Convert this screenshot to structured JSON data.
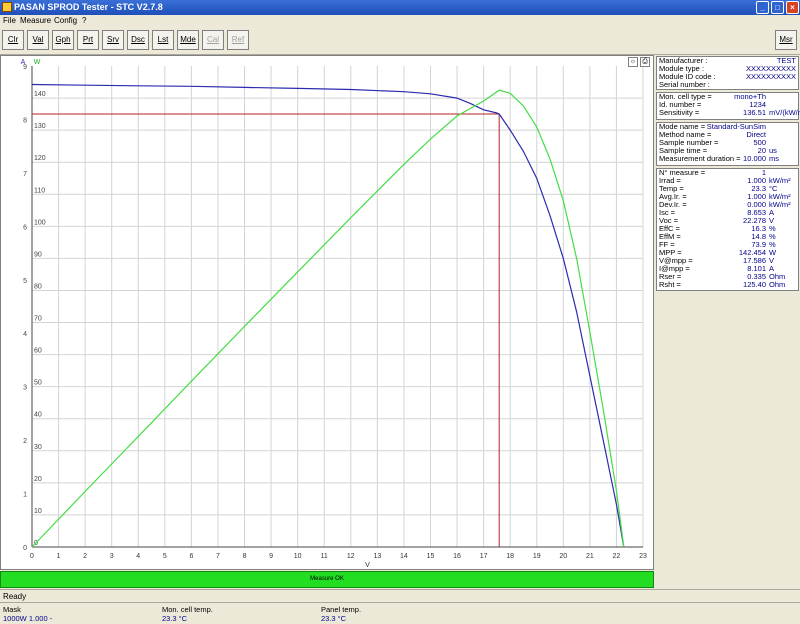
{
  "window": {
    "title": "PASAN SPROD Tester - STC V2.7.8"
  },
  "menu": [
    "File",
    "Measure",
    "Config",
    "?"
  ],
  "toolbar": {
    "buttons": [
      "Clr",
      "Val",
      "Gph",
      "Prt",
      "Srv",
      "Dsc",
      "Lst",
      "Mde",
      "Cal",
      "Ref"
    ],
    "right_button": "Msr"
  },
  "chart_data": {
    "type": "line",
    "xlabel": "V",
    "y_left_label": "A",
    "y_right_label": "W",
    "xlim": [
      0,
      23
    ],
    "ylim_current": [
      0,
      9
    ],
    "ylim_power": [
      0,
      150
    ],
    "x_ticks": [
      "0",
      "1",
      "2",
      "3",
      "4",
      "5",
      "6",
      "7",
      "8",
      "9",
      "10",
      "11",
      "12",
      "13",
      "14",
      "15",
      "16",
      "17",
      "18",
      "19",
      "20",
      "21",
      "22",
      "23"
    ],
    "y_current_ticks": [
      "0",
      "1",
      "2",
      "3",
      "4",
      "5",
      "6",
      "7",
      "8",
      "9"
    ],
    "y_power_ticks": [
      "0",
      "10",
      "20",
      "30",
      "40",
      "50",
      "60",
      "70",
      "80",
      "90",
      "100",
      "110",
      "120",
      "130",
      "140"
    ],
    "series": [
      {
        "name": "Current",
        "color": "#2b2bb0",
        "x": [
          0,
          2,
          4,
          6,
          8,
          10,
          12,
          14,
          15,
          16,
          16.5,
          17,
          17.5,
          17.586,
          18,
          18.5,
          19,
          19.5,
          20,
          20.5,
          21,
          21.5,
          22,
          22.278
        ],
        "y": [
          8.653,
          8.64,
          8.63,
          8.62,
          8.6,
          8.58,
          8.56,
          8.52,
          8.48,
          8.4,
          8.3,
          8.18,
          8.12,
          8.101,
          7.8,
          7.4,
          6.9,
          6.2,
          5.4,
          4.4,
          3.2,
          2.0,
          0.8,
          0.0
        ]
      },
      {
        "name": "Power",
        "color": "#44dd44",
        "x": [
          0,
          2,
          4,
          6,
          8,
          10,
          12,
          14,
          15,
          16,
          17,
          17.586,
          18,
          18.5,
          19,
          19.5,
          20,
          20.5,
          21,
          21.5,
          22,
          22.278
        ],
        "y": [
          0,
          17.3,
          34.5,
          51.7,
          68.8,
          85.8,
          102.7,
          119.3,
          127.2,
          134.4,
          139.1,
          142.454,
          141.5,
          137.5,
          131.0,
          121.0,
          108.0,
          90.0,
          67.0,
          43.0,
          17.6,
          0.0
        ]
      }
    ],
    "mpp_marker": {
      "x": 17.586,
      "y_current": 8.101
    },
    "grid": true
  },
  "status_ok_text": "Measure OK",
  "panel1": [
    {
      "label": "Manufacturer :",
      "value": "TEST"
    },
    {
      "label": "Module type :",
      "value": "XXXXXXXXXX"
    },
    {
      "label": "Module ID code :",
      "value": "XXXXXXXXXX"
    },
    {
      "label": "Serial number :",
      "value": ""
    }
  ],
  "panel2": [
    {
      "label": "Mon. cell type =",
      "value": "mono+Th",
      "unit": ""
    },
    {
      "label": "Id. number =",
      "value": "1234",
      "unit": ""
    },
    {
      "label": "Sensitivity =",
      "value": "136.51",
      "unit": "mV/(kW/m²)"
    }
  ],
  "panel3": [
    {
      "label": "Mode name =",
      "value": "Standard-SunSim",
      "unit": ""
    },
    {
      "label": "Method name =",
      "value": "Direct",
      "unit": ""
    },
    {
      "label": "Sample number =",
      "value": "500",
      "unit": ""
    },
    {
      "label": "Sample time =",
      "value": "20",
      "unit": "us"
    },
    {
      "label": "Measurement duration =",
      "value": "10.000",
      "unit": "ms"
    }
  ],
  "panel4": [
    {
      "label": "N° measure =",
      "value": "1",
      "unit": ""
    },
    {
      "label": "Irrad =",
      "value": "1.000",
      "unit": "kW/m²"
    },
    {
      "label": "Temp =",
      "value": "23.3",
      "unit": "°C"
    },
    {
      "label": "Avg.Ir. =",
      "value": "1.000",
      "unit": "kW/m²"
    },
    {
      "label": "Dev.Ir. =",
      "value": "0.000",
      "unit": "kW/m²"
    },
    {
      "label": "Isc =",
      "value": "8.653",
      "unit": "A"
    },
    {
      "label": "Voc =",
      "value": "22.278",
      "unit": "V"
    },
    {
      "label": "EffC =",
      "value": "16.3",
      "unit": "%"
    },
    {
      "label": "EffM =",
      "value": "14.8",
      "unit": "%"
    },
    {
      "label": "FF =",
      "value": "73.9",
      "unit": "%"
    },
    {
      "label": "MPP =",
      "value": "142.454",
      "unit": "W"
    },
    {
      "label": "V@mpp =",
      "value": "17.586",
      "unit": "V"
    },
    {
      "label": "I@mpp =",
      "value": "8.101",
      "unit": "A"
    },
    {
      "label": "Rser =",
      "value": "0.335",
      "unit": "Ohm"
    },
    {
      "label": "Rsht =",
      "value": "125.40",
      "unit": "Ohm"
    }
  ],
  "statusbar": {
    "text": "Ready"
  },
  "footer": {
    "mask_label": "Mask",
    "mask_value": "1000W 1.000 -",
    "moncell_label": "Mon. cell temp.",
    "moncell_value": "23.3 °C",
    "panel_label": "Panel temp.",
    "panel_value": "23.3 °C"
  }
}
